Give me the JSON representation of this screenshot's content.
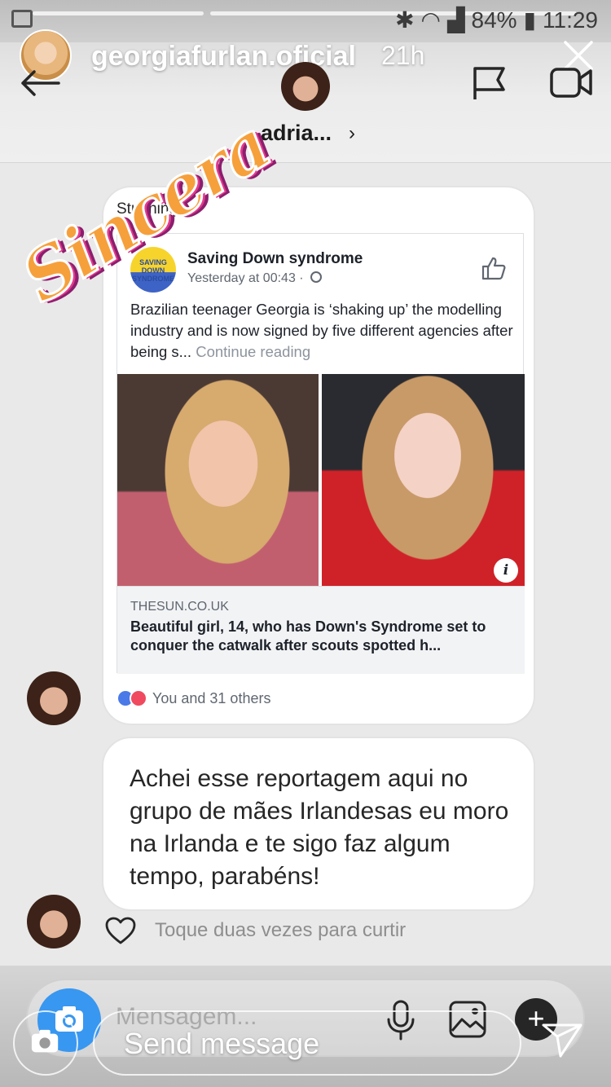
{
  "status": {
    "battery": "84%",
    "time": "11:29"
  },
  "story": {
    "username": "georgiafurlan.oficial",
    "time_ago": "21h",
    "sticker_text": "Sincera",
    "reply_placeholder": "Send message"
  },
  "chat": {
    "contact_name": "adria...",
    "share_caption": "Stunning.",
    "fb_post": {
      "page_avatar_text": "SAVING DOWN SYNDROME",
      "page_name": "Saving Down syndrome",
      "timestamp": "Yesterday at 00:43 ·",
      "text": "Brazilian teenager Georgia is ‘shaking up’ the modelling industry and is now signed by five different agencies after being s...",
      "continue": "Continue reading",
      "link_domain": "THESUN.CO.UK",
      "link_headline": "Beautiful girl, 14, who has Down's Syndrome set to conquer the catwalk after scouts spotted h...",
      "reactions_text": "You and 31 others"
    },
    "message_text": "Achei esse reportagem aqui no grupo de mães Irlandesas eu moro na Irlanda e te sigo faz algum tempo, parabéns!",
    "like_hint": "Toque duas vezes para curtir",
    "composer_placeholder": "Mensagem..."
  },
  "colors": {
    "instagram_blue": "#3897f0",
    "fb_like": "#4a7ae8",
    "fb_love": "#ef4a5f"
  }
}
